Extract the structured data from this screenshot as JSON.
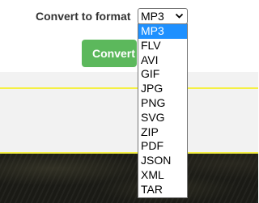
{
  "form": {
    "label": "Convert to format",
    "selected_format": "MP3",
    "convert_button_label": "Convert"
  },
  "dropdown": {
    "options": [
      "MP3",
      "FLV",
      "AVI",
      "GIF",
      "JPG",
      "PNG",
      "SVG",
      "ZIP",
      "PDF",
      "JSON",
      "XML",
      "TAR"
    ],
    "selected_index": 0
  },
  "icons": {
    "select_chevron": "chevron-down-icon"
  },
  "colors": {
    "button_green": "#5cb85c",
    "selected_highlight": "#1e90ff",
    "accent_yellow": "#f5f044",
    "band_gray": "#f2f2f2"
  }
}
